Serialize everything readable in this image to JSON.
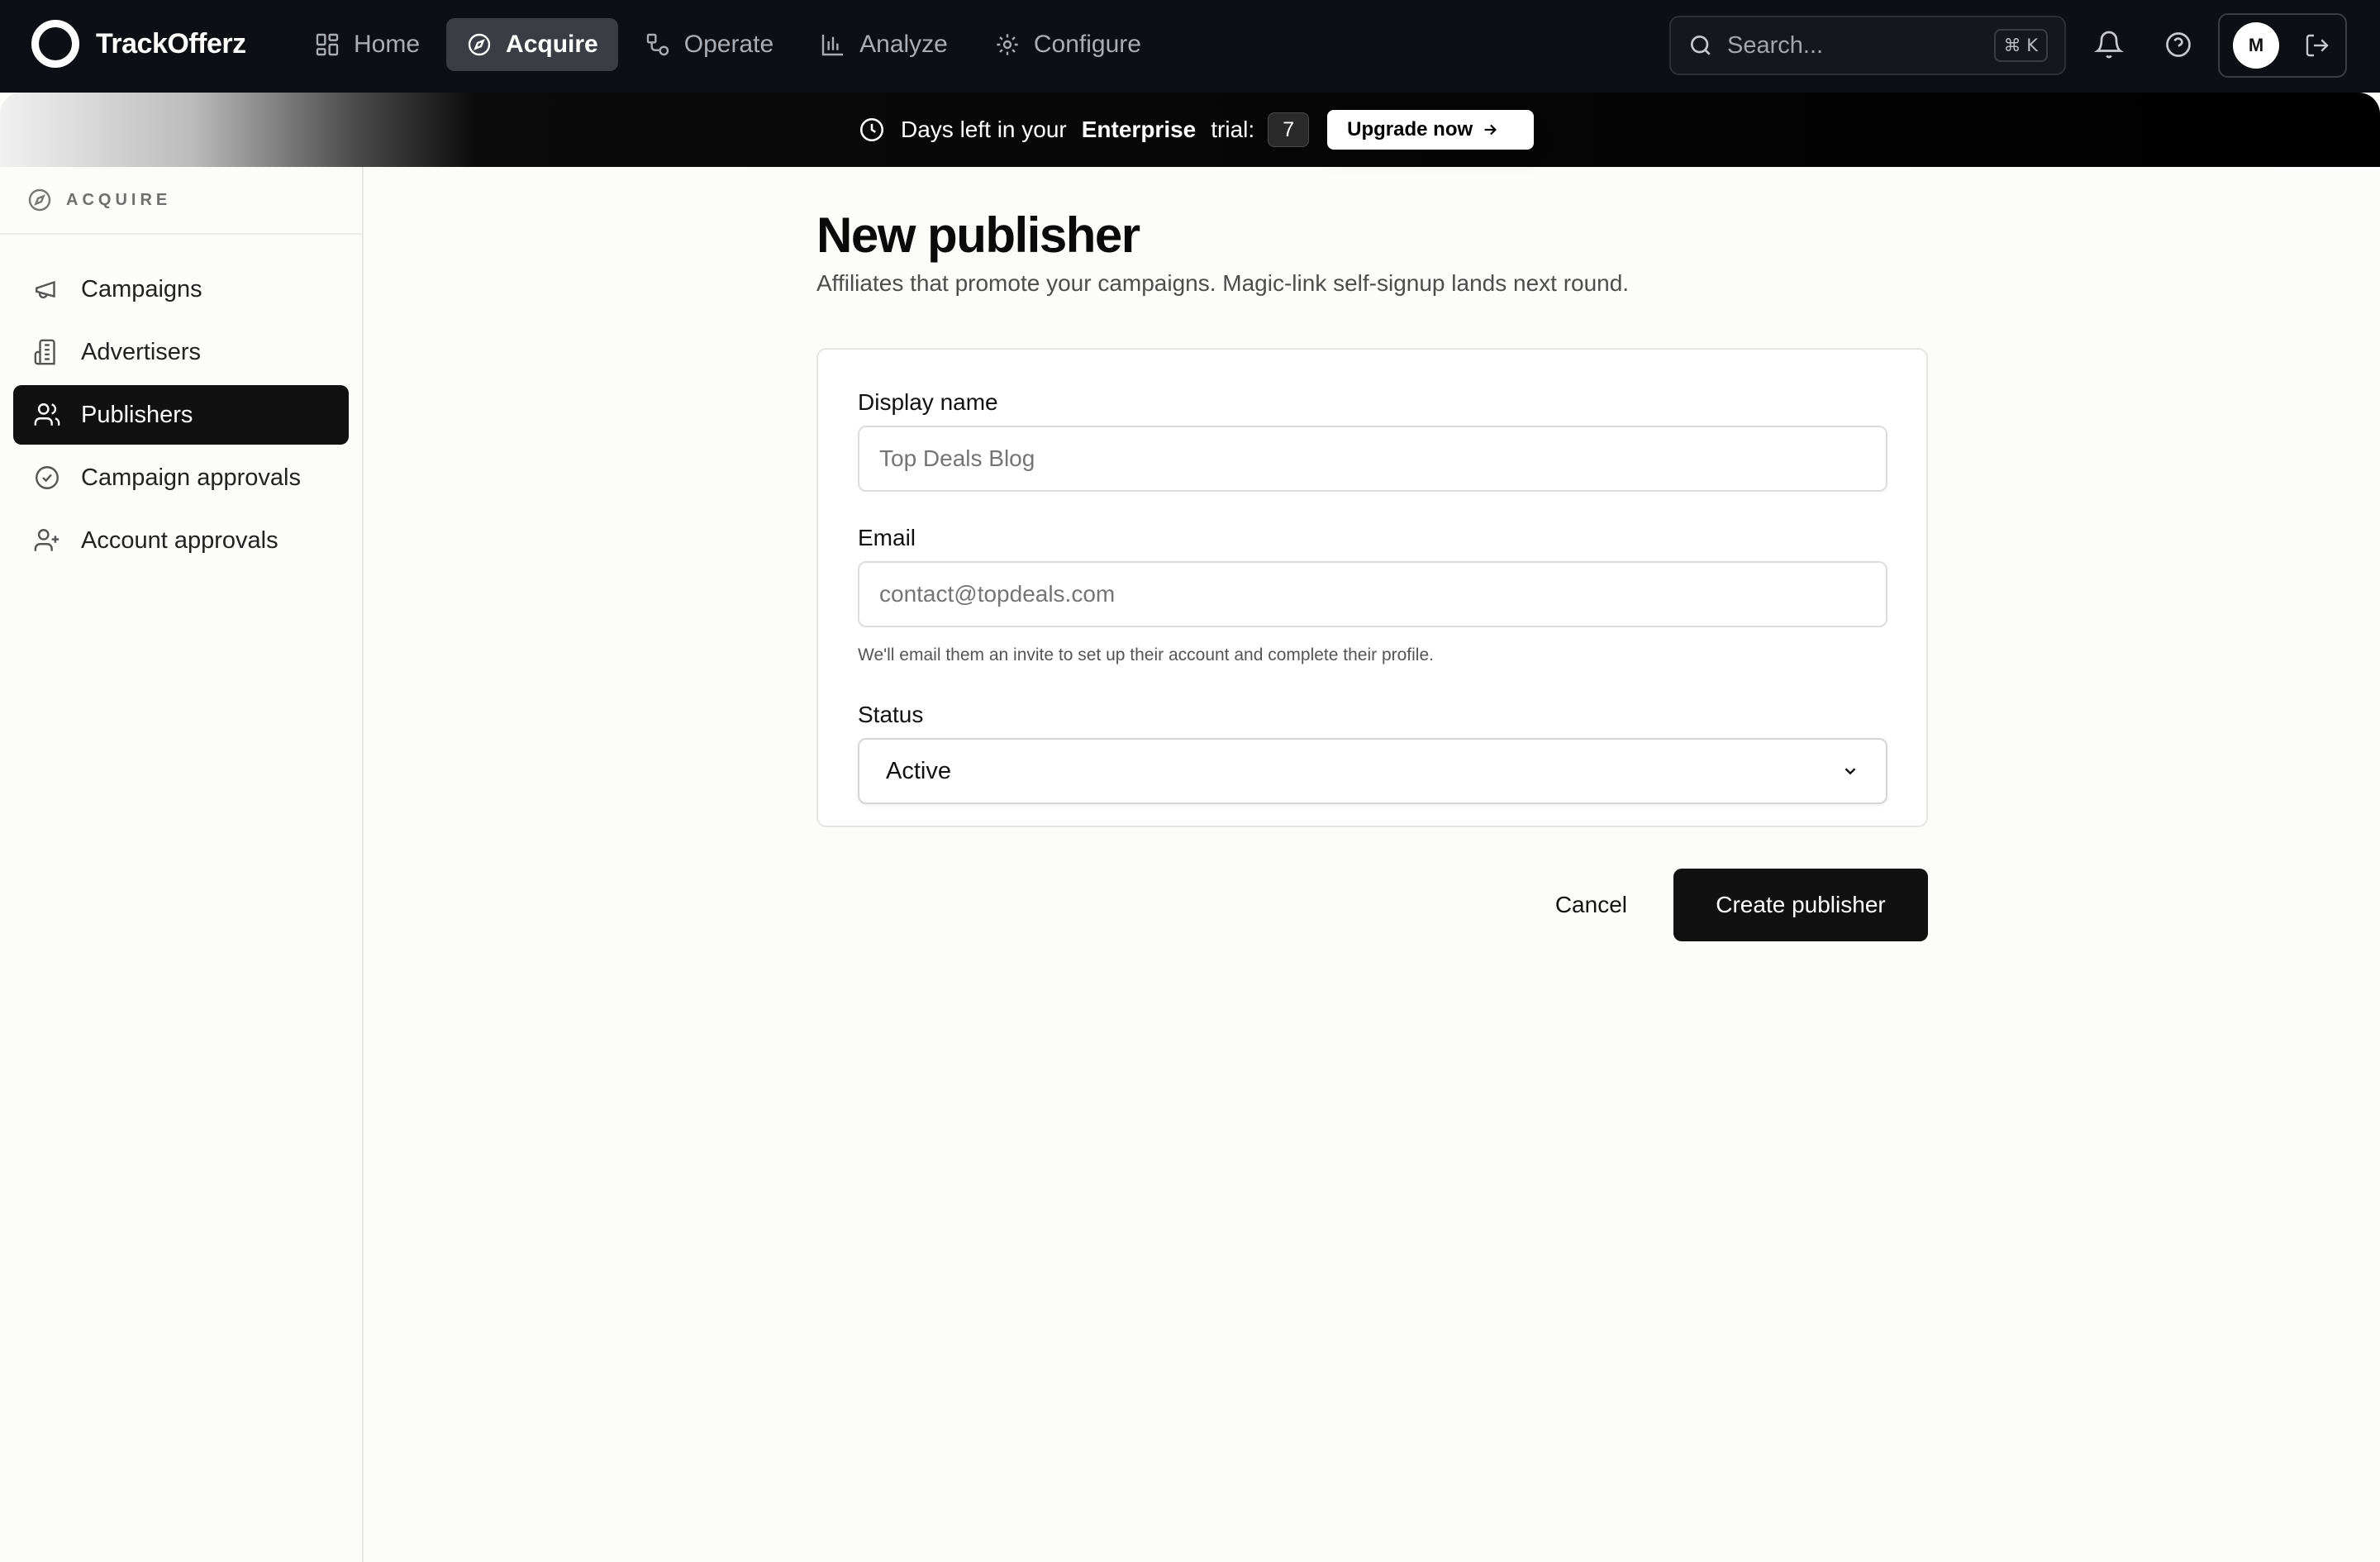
{
  "app": {
    "name": "TrackOfferz"
  },
  "nav": [
    {
      "label": "Home",
      "icon": "grid-icon"
    },
    {
      "label": "Acquire",
      "icon": "compass-icon",
      "active": true
    },
    {
      "label": "Operate",
      "icon": "workflow-icon"
    },
    {
      "label": "Analyze",
      "icon": "bar-chart-icon"
    },
    {
      "label": "Configure",
      "icon": "gear-icon"
    }
  ],
  "search": {
    "placeholder": "Search...",
    "shortcut": "⌘ K"
  },
  "account": {
    "initial": "M"
  },
  "trial": {
    "prefix": "Days left in your",
    "plan": "Enterprise",
    "suffix": "trial:",
    "days": "7",
    "upgrade_label": "Upgrade now"
  },
  "sidebar": {
    "section": "ACQUIRE",
    "items": [
      {
        "label": "Campaigns",
        "icon": "megaphone-icon"
      },
      {
        "label": "Advertisers",
        "icon": "building-icon"
      },
      {
        "label": "Publishers",
        "icon": "users-icon",
        "active": true
      },
      {
        "label": "Campaign approvals",
        "icon": "check-circle-icon"
      },
      {
        "label": "Account approvals",
        "icon": "user-plus-icon"
      }
    ]
  },
  "page": {
    "title": "New publisher",
    "subtitle": "Affiliates that promote your campaigns. Magic-link self-signup lands next round."
  },
  "form": {
    "display_name": {
      "label": "Display name",
      "placeholder": "Top Deals Blog"
    },
    "email": {
      "label": "Email",
      "placeholder": "contact@topdeals.com",
      "hint": "We'll email them an invite to set up their account and complete their profile."
    },
    "status": {
      "label": "Status",
      "value": "Active"
    }
  },
  "actions": {
    "cancel": "Cancel",
    "submit": "Create publisher"
  }
}
